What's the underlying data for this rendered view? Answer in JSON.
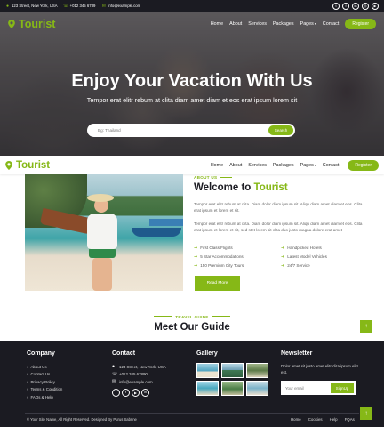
{
  "topbar": {
    "address": "123 Street, New York, USA",
    "phone": "+012 345 6789",
    "email": "info@example.com",
    "socials": [
      "twitter-icon",
      "facebook-icon",
      "linkedin-icon",
      "instagram-icon",
      "youtube-icon"
    ]
  },
  "brand": {
    "name": "Tourist",
    "accent": "#86b817",
    "dark": "#1b1b22"
  },
  "nav": {
    "items": [
      "Home",
      "About",
      "Services",
      "Packages",
      "Pages",
      "Contact"
    ],
    "register": "Register"
  },
  "hero": {
    "title": "Enjoy Your Vacation With Us",
    "subtitle": "Tempor erat elitr rebum at clita diam amet diam et eos erat ipsum lorem sit",
    "search_placeholder": "Eg: Thailand",
    "search_button": "Search"
  },
  "about": {
    "tag": "ABOUT US",
    "title_prefix": "Welcome to ",
    "title_accent": "Tourist",
    "para1": "Tempor erat elitr rebum at clita. Diam dolor diam ipsum sit. Aliqu diam amet diam et eos. Clita erat ipsum et lorem et sit.",
    "para2": "Tempor erat elitr rebum at clita. Diam dolor diam ipsum sit. Aliqu diam amet diam et eos. Clita erat ipsum et lorem et sit, sed stet lorem sit clita duo justo magna dolore erat amet",
    "features": [
      "First Class Flights",
      "Handpicked Hotels",
      "5 Star Accommodations",
      "Latest Model Vehicles",
      "150 Premium City Tours",
      "24/7 Service"
    ],
    "button": "Read More"
  },
  "guide": {
    "tag": "TRAVEL GUIDE",
    "title": "Meet Our Guide"
  },
  "footer": {
    "company": {
      "heading": "Company",
      "links": [
        "About Us",
        "Contact Us",
        "Privacy Policy",
        "Terms & Condition",
        "FAQs & Help"
      ]
    },
    "contact": {
      "heading": "Contact",
      "address": "123 Street, New York, USA",
      "phone": "+012 345 67890",
      "email": "info@example.com"
    },
    "gallery": {
      "heading": "Gallery"
    },
    "newsletter": {
      "heading": "Newsletter",
      "text": "Dolor amet sit justo amet elitr clita ipsum elitr est.",
      "placeholder": "Your email",
      "button": "SignUp"
    },
    "copyright": "© Your Site Name, All Right Reserved. Designed By Purus Sabrine",
    "bottom_links": [
      "Home",
      "Cookies",
      "Help",
      "FQAs"
    ]
  }
}
